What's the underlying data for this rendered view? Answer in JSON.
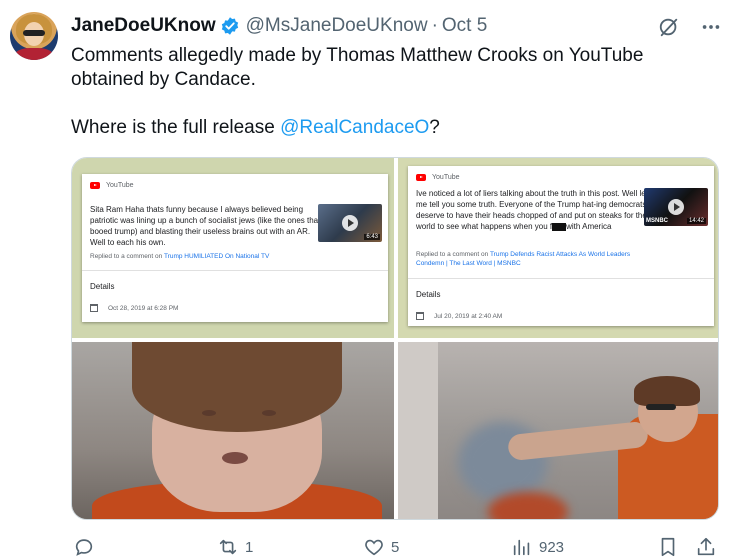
{
  "author": {
    "display_name": "JaneDoeUKnow",
    "handle": "@MsJaneDoeUKnow",
    "separator": "·",
    "date": "Oct 5",
    "verified": true
  },
  "tweet": {
    "text_line1": "Comments allegedly made by Thomas Matthew Crooks on YouTube",
    "text_line2": "obtained by Candace.",
    "text_line3_prefix": "Where is the full release ",
    "mention": "@RealCandaceO",
    "text_line3_suffix": "?"
  },
  "media": {
    "card1": {
      "source": "YouTube",
      "comment": "Sita Ram Haha thats funny because I always believed being patriotic was lining up a bunch of socialist jews (like the ones that booed trump) and blasting their useless brains out with an AR. Well to each his own.",
      "replied_prefix": "Replied to a comment on ",
      "replied_link": "Trump HUMILIATED On National TV",
      "details": "Details",
      "timestamp": "Oct 28, 2019 at 6:28 PM",
      "thumb_duration": "6:43"
    },
    "card2": {
      "source": "YouTube",
      "comment_a": "Ive noticed a lot of liers talking about the truth in this post. Well let me tell you some truth. Everyone of the Trump hat-ing democrats deserve to have their heads chopped of and put on steaks for the world to see what happens when you f",
      "comment_b": "with America",
      "replied_prefix": "Replied to a comment on ",
      "replied_link": "Trump Defends Racist Attacks As World Leaders Condemn | The Last Word | MSNBC",
      "details": "Details",
      "timestamp": "Jul 20, 2019 at 2:40 AM",
      "thumb_duration": "14:42",
      "thumb_label": "MSNBC"
    }
  },
  "actions": {
    "replies": "",
    "retweets": "1",
    "likes": "5",
    "views": "923"
  },
  "icons": [
    "verified-badge-icon",
    "grok-icon",
    "more-icon",
    "reply-icon",
    "retweet-icon",
    "like-icon",
    "views-icon",
    "bookmark-icon",
    "share-icon"
  ],
  "colors": {
    "accent": "#1d9bf0",
    "muted": "#536471",
    "text": "#0f1419"
  }
}
